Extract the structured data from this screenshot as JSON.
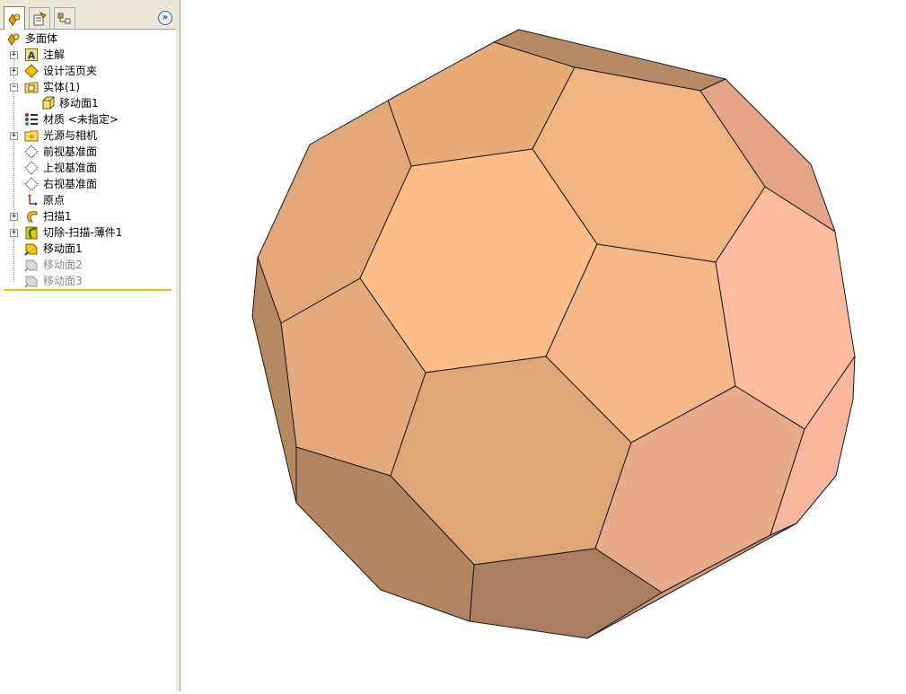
{
  "feature_tree": {
    "tabs": [
      {
        "name": "feature-manager-icon"
      },
      {
        "name": "property-manager-icon"
      },
      {
        "name": "configuration-manager-icon"
      }
    ],
    "expand_icon": "»",
    "items": [
      {
        "label": "多面体"
      },
      {
        "label": "注解"
      },
      {
        "label": "设计活页夹"
      },
      {
        "label": "实体(1)"
      },
      {
        "label": "移动面1"
      },
      {
        "label": "材质 <未指定>"
      },
      {
        "label": "光源与相机"
      },
      {
        "label": "前视基准面"
      },
      {
        "label": "上视基准面"
      },
      {
        "label": "右视基准面"
      },
      {
        "label": "原点"
      },
      {
        "label": "扫描1"
      },
      {
        "label": "切除-扫描-薄件1"
      },
      {
        "label": "移动面1"
      },
      {
        "label": "移动面2"
      },
      {
        "label": "移动面3"
      }
    ],
    "colors": {
      "rollback_bar": "#e8c400"
    }
  },
  "model": {
    "name": "truncated-icosahedron",
    "colors": {
      "face_light": "#fdbd88",
      "face_mid": "#f0b489",
      "face_dark": "#b08665",
      "face_pink": "#fdbba0",
      "edge": "#1a1a1a"
    }
  }
}
